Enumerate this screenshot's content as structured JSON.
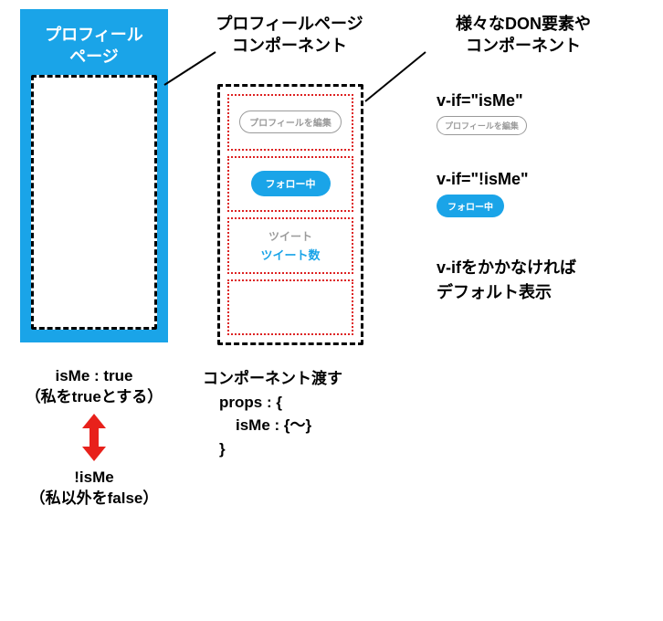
{
  "col1": {
    "title_line1": "プロフィール",
    "title_line2": "ページ",
    "caption_line1": "isMe : true",
    "caption_line2": "（私をtrueとする）",
    "bottom_line1": "!isMe",
    "bottom_line2": "（私以外をfalse）"
  },
  "col2": {
    "title_line1": "プロフィールページ",
    "title_line2": "コンポーネント",
    "cells": {
      "edit_profile": "プロフィールを編集",
      "following": "フォロー中",
      "tweet_label": "ツイート",
      "tweet_count": "ツイート数"
    },
    "caption_line1": "コンポーネント渡す",
    "caption_line2": "props : {",
    "caption_line3": "isMe : {〜}",
    "caption_line4": "}"
  },
  "col3": {
    "title_line1": "様々なDON要素や",
    "title_line2": "コンポーネント",
    "ex1_label": "v-if=\"isMe\"",
    "ex1_pill": "プロフィールを編集",
    "ex2_label": "v-if=\"!isMe\"",
    "ex2_pill": "フォロー中",
    "ex3_line1": "v-ifをかかなければ",
    "ex3_line2": "デフォルト表示"
  }
}
